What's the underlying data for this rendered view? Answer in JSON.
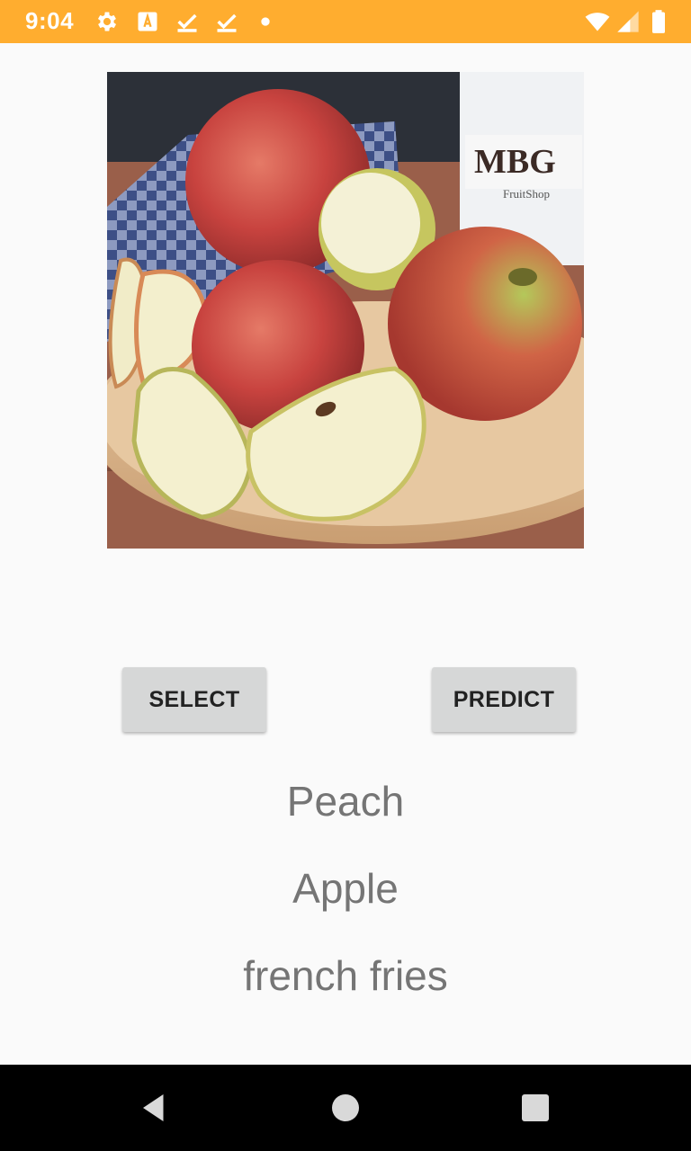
{
  "status_bar": {
    "time": "9:04",
    "color": "#ffad2f",
    "icons": [
      "settings-icon",
      "font-icon",
      "download-done-icon",
      "download-done-icon",
      "dot-icon",
      "wifi-icon",
      "cell-signal-icon",
      "battery-icon"
    ]
  },
  "image": {
    "description_icon": "fruit-photo",
    "jar_label_text": "MBG",
    "jar_sublabel_text": "FruitShop"
  },
  "buttons": {
    "select_label": "SELECT",
    "predict_label": "PREDICT"
  },
  "results": [
    "Peach",
    "Apple",
    "french fries"
  ],
  "nav_bar": {
    "icons": [
      "back-icon",
      "home-icon",
      "recents-icon"
    ]
  }
}
